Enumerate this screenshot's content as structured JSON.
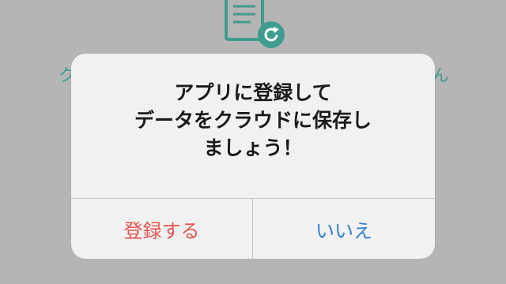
{
  "background": {
    "icon": "document-refresh-icon",
    "left_fragment": "ク",
    "right_fragment": "ん"
  },
  "dialog": {
    "message": "アプリに登録して\nデータをクラウドに保存し\nましょう！",
    "register_label": "登録する",
    "no_label": "いいえ"
  },
  "colors": {
    "register": "#e8524e",
    "no": "#2f7fd6",
    "accent": "#3f9c8f"
  }
}
